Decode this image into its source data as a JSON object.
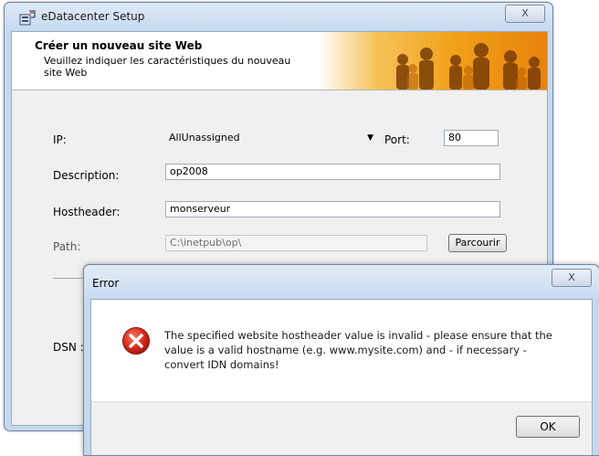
{
  "window": {
    "title": "eDatacenter Setup",
    "close_glyph": "X",
    "icon": "installer-icon"
  },
  "banner": {
    "title": "Créer un nouveau site Web",
    "subtitle": "Veuillez indiquer les caractéristiques du nouveau site Web"
  },
  "form": {
    "ip_label": "IP:",
    "ip_value": "AllUnassigned",
    "port_label": "Port:",
    "port_value": "80",
    "description_label": "Description:",
    "description_value": "op2008",
    "hostheader_label": "Hostheader:",
    "hostheader_value": "monserveur",
    "path_label": "Path:",
    "path_value": "C:\\inetpub\\op\\",
    "browse_label": "Parcourir",
    "dsn_label": "DSN :"
  },
  "error_dialog": {
    "title": "Error",
    "close_glyph": "X",
    "icon": "error-icon",
    "message": "The specified website hostheader value is invalid - please ensure that the value  is a valid hostname (e.g. www.mysite.com) and - if necessary - convert IDN domains!",
    "ok_label": "OK"
  }
}
